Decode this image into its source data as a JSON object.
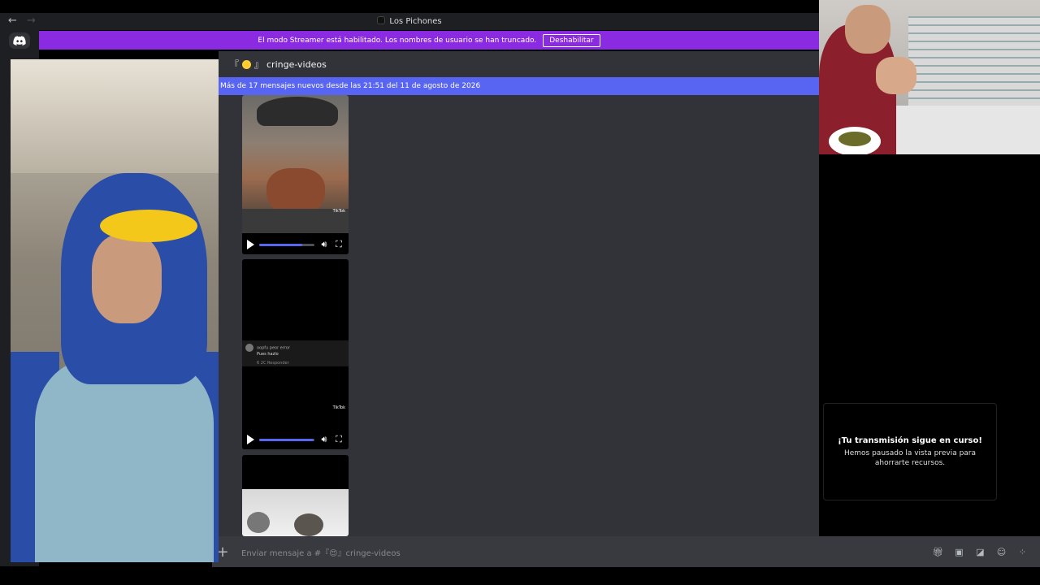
{
  "window": {
    "title": "Los Pichones",
    "nav_back": "←",
    "nav_forward": "→"
  },
  "banner": {
    "message": "El modo Streamer está habilitado. Los nombres de usuario se han truncado.",
    "button_label": "Deshabilitar",
    "color": "#8a2be2"
  },
  "channel": {
    "prefix": "『",
    "suffix": "』",
    "name": "cringe-videos"
  },
  "new_messages_bar": {
    "text": "Más de 17 mensajes nuevos desde las 21:51 del 11 de agosto de 2026",
    "color": "#5865f2"
  },
  "videos": [
    {
      "watermark": "TikTok",
      "progress": 0.78
    },
    {
      "watermark": "TikTok",
      "progress": 0.98,
      "comment_author": "oopfu peor error",
      "comment_text": "Pues hazlo",
      "comment_meta": "6 2C   Responder"
    },
    {
      "watermark": ""
    }
  ],
  "composer": {
    "placeholder": "Enviar mensaje a #『😍』cringe-videos",
    "tools": [
      "gift-icon",
      "gif-icon",
      "sticker-icon",
      "emoji-icon",
      "apps-icon"
    ]
  },
  "stream_notice": {
    "title": "¡Tu transmisión sigue en curso!",
    "body": "Hemos pausado la vista previa para ahorrarte recursos."
  }
}
